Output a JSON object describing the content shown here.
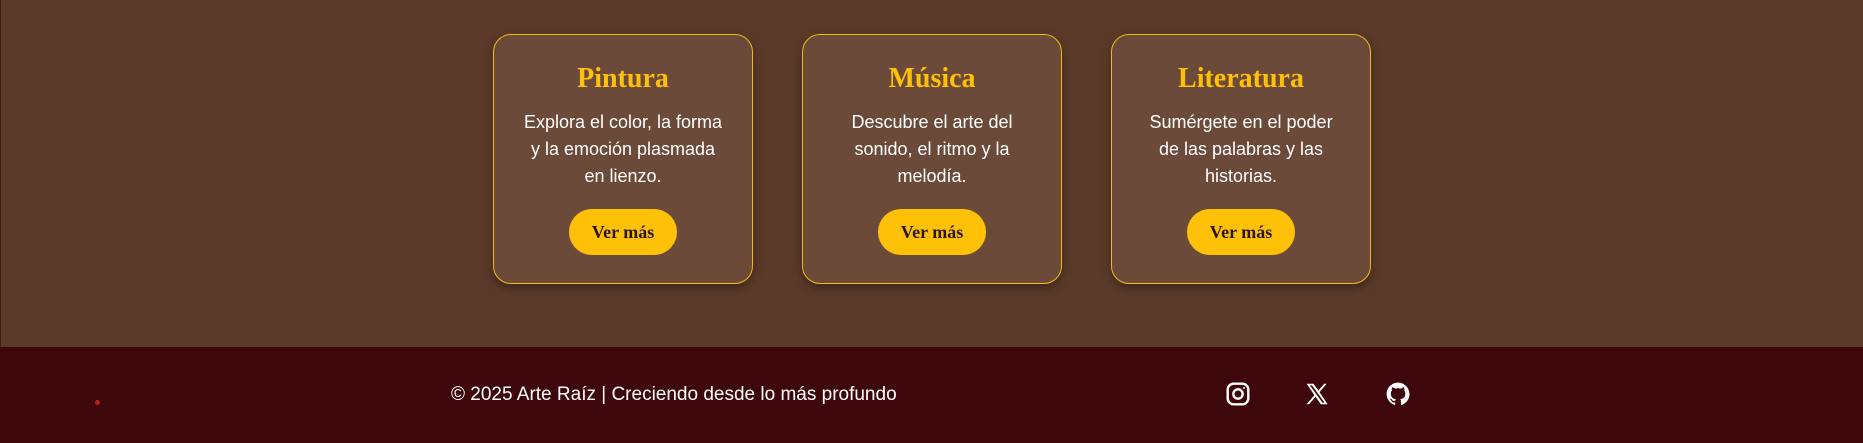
{
  "cards": [
    {
      "title": "Pintura",
      "description": "Explora el color, la forma y la emoción plasmada en lienzo.",
      "button_label": "Ver más"
    },
    {
      "title": "Música",
      "description": "Descubre el arte del sonido, el ritmo y la melodía.",
      "button_label": "Ver más"
    },
    {
      "title": "Literatura",
      "description": "Sumérgete en el poder de las palabras y las historias.",
      "button_label": "Ver más"
    }
  ],
  "footer": {
    "copyright": "© 2025 Arte Raíz | Creciendo desde lo más profundo",
    "social": [
      {
        "icon": "instagram-icon"
      },
      {
        "icon": "x-icon"
      },
      {
        "icon": "github-icon"
      }
    ]
  },
  "colors": {
    "background": "#5b3a2a",
    "card_background": "#6b4a39",
    "accent": "#ffc107",
    "footer_background": "#3d070c"
  }
}
